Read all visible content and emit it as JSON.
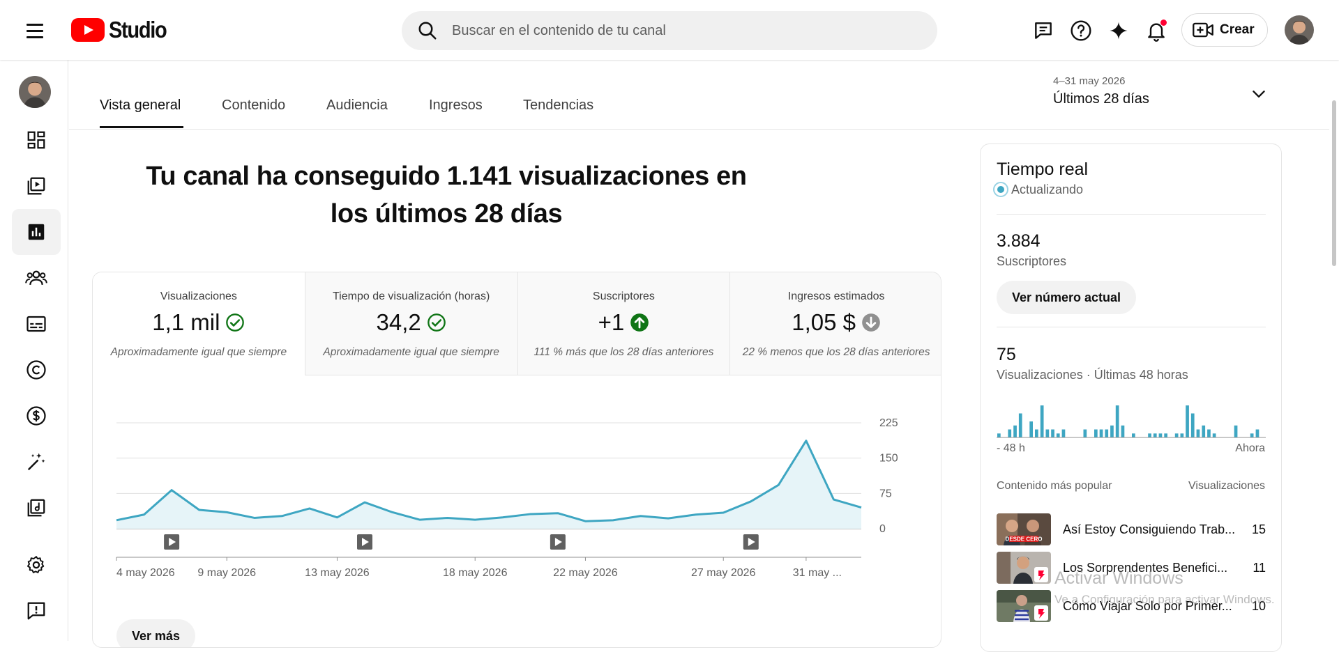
{
  "header": {
    "logo_text": "Studio",
    "search_placeholder": "Buscar en el contenido de tu canal",
    "create_label": "Crear"
  },
  "tabs": {
    "items": [
      "Vista general",
      "Contenido",
      "Audiencia",
      "Ingresos",
      "Tendencias"
    ],
    "active": "Vista general"
  },
  "date_range": {
    "range": "4–31 may 2026",
    "label": "Últimos 28 días"
  },
  "headline": "Tu canal ha conseguido 1.141 visualizaciones en los últimos 28 días",
  "metrics": [
    {
      "label": "Visualizaciones",
      "value": "1,1 mil",
      "status": "check-icon",
      "note": "Aproximadamente igual que siempre"
    },
    {
      "label": "Tiempo de visualización (horas)",
      "value": "34,2",
      "status": "check-icon",
      "note": "Aproximadamente igual que siempre"
    },
    {
      "label": "Suscriptores",
      "value": "+1",
      "status": "arrow-up-icon",
      "note": "111 % más que los 28 días anteriores"
    },
    {
      "label": "Ingresos estimados",
      "value": "1,05 $",
      "status": "arrow-down-icon",
      "note": "22 % menos que los 28 días anteriores"
    }
  ],
  "chart_data": {
    "type": "area",
    "title": "",
    "xlabel": "",
    "ylabel": "",
    "x": [
      "4 may 2026",
      "5 may",
      "6 may",
      "7 may",
      "8 may",
      "9 may 2026",
      "10 may",
      "11 may",
      "12 may",
      "13 may 2026",
      "14 may",
      "15 may",
      "16 may",
      "17 may",
      "18 may 2026",
      "19 may",
      "20 may",
      "21 may",
      "22 may 2026",
      "23 may",
      "24 may",
      "25 may",
      "26 may",
      "27 may 2026",
      "28 may",
      "29 may",
      "30 may",
      "31 may 2026"
    ],
    "values": [
      18,
      30,
      82,
      40,
      35,
      23,
      27,
      43,
      24,
      56,
      35,
      19,
      23,
      19,
      24,
      31,
      33,
      16,
      18,
      27,
      22,
      30,
      34,
      58,
      93,
      187,
      62,
      45
    ],
    "yticks": [
      0,
      75,
      150,
      225
    ],
    "ylim": [
      0,
      225
    ],
    "xtick_labels": [
      "4 may 2026",
      "9 may 2026",
      "13 may 2026",
      "18 may 2026",
      "22 may 2026",
      "27 may 2026",
      "31 may ..."
    ],
    "xtick_indices": [
      0,
      4,
      8,
      13,
      17,
      22,
      25
    ],
    "video_markers": [
      2,
      9,
      16,
      23
    ],
    "color": "#3ea6c2",
    "fill": "#e6f4f8",
    "grid": true
  },
  "more_label": "Ver más",
  "realtime": {
    "title": "Tiempo real",
    "status": "Actualizando",
    "subscribers": "3.884",
    "subscribers_label": "Suscriptores",
    "button_label": "Ver número actual",
    "views": "75",
    "views_label": "Visualizaciones · Últimas 48 horas",
    "axis_start": "- 48 h",
    "axis_end": "Ahora",
    "hourly_views": [
      1,
      0,
      2,
      3,
      6,
      0,
      4,
      2,
      8,
      2,
      2,
      1,
      2,
      0,
      0,
      0,
      2,
      0,
      2,
      2,
      2,
      3,
      8,
      3,
      0,
      1,
      0,
      0,
      1,
      1,
      1,
      1,
      0,
      1,
      1,
      8,
      6,
      2,
      3,
      2,
      1,
      0,
      0,
      0,
      3,
      0,
      0,
      1,
      2,
      0
    ],
    "top_content_label": "Contenido más popular",
    "top_views_label": "Visualizaciones",
    "top_content": [
      {
        "title": "Así Estoy Consiguiendo Trab...",
        "views": "15",
        "thumb": "person-thumb-a",
        "thumb_text": "DESDE CERO"
      },
      {
        "title": "Los Sorprendentes Benefici...",
        "views": "11",
        "thumb": "person-thumb-b"
      },
      {
        "title": "Cómo Viajar Solo por Primer...",
        "views": "10",
        "thumb": "person-thumb-c"
      }
    ]
  },
  "watermark": {
    "line1": "Activar Windows",
    "line2": "Ve a Configuración para activar Windows."
  },
  "colors": {
    "accent": "#3ea6c2",
    "success": "#107516",
    "brand": "#ff0000"
  }
}
